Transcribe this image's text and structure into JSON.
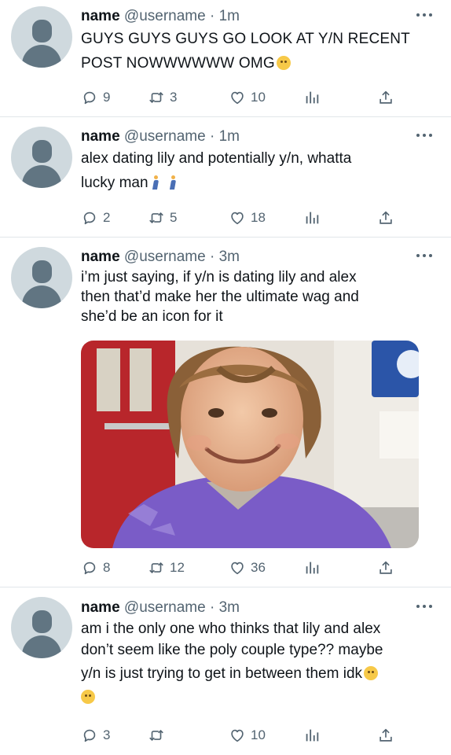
{
  "tweets": [
    {
      "name": "name",
      "handle_time": "@username · 1m",
      "text_lines": [
        "GUYS GUYS GUYS  GO LOOK AT Y/N RECENT",
        "POST NOWWWWWW OMG"
      ],
      "replies": "9",
      "retweets": "3",
      "likes": "10"
    },
    {
      "name": "name",
      "handle_time": "@username · 1m",
      "text_lines": [
        "alex dating lily and potentially y/n, whatta",
        "lucky man"
      ],
      "replies": "2",
      "retweets": "5",
      "likes": "18"
    },
    {
      "name": "name",
      "handle_time": "@username · 3m",
      "text_lines": [
        "i’m just saying, if y/n is dating lily and alex",
        "then that’d make her the ultimate wag and",
        "she’d be an icon for it"
      ],
      "replies": "8",
      "retweets": "12",
      "likes": "36"
    },
    {
      "name": "name",
      "handle_time": "@username · 3m",
      "text_lines": [
        "am i the only one who thinks that lily and alex",
        "don’t seem like the poly couple type?? maybe",
        "y/n is just trying to get in between them idk"
      ],
      "replies": "3",
      "retweets": "",
      "likes": "10"
    }
  ],
  "colors": {
    "text": "#0f1419",
    "secondary": "#536471",
    "avatar_bg": "#cfd9de",
    "avatar_fg": "#617582",
    "divider": "#e1e6ea"
  },
  "icons": [
    "reply-icon",
    "retweet-icon",
    "like-icon",
    "analytics-icon",
    "share-icon",
    "more-icon"
  ]
}
